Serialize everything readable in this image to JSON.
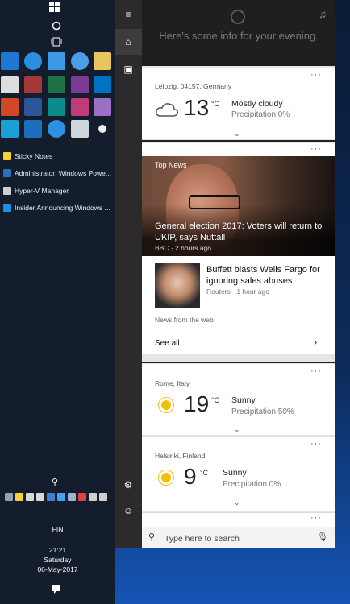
{
  "taskbar": {
    "running_apps": [
      {
        "label": "Sticky Notes",
        "color": "#f5d327"
      },
      {
        "label": "Administrator: Windows Powe...",
        "color": "#2e6fbf"
      },
      {
        "label": "Hyper-V Manager",
        "color": "#cfcfcf"
      },
      {
        "label": "Insider Announcing Windows ...",
        "color": "#1e8ee0"
      }
    ],
    "language": "FIN",
    "time": "21:21",
    "day": "Saturday",
    "date": "06-May-2017"
  },
  "cortana": {
    "greeting": "Here's some info for your evening."
  },
  "weather_cards": [
    {
      "location": "Leipzig, 04157, Germany",
      "temp": "13",
      "unit": "°C",
      "condition": "Mostly cloudy",
      "precipitation": "Precipitation 0%",
      "icon": "cloud-icon"
    },
    {
      "location": "Rome, Italy",
      "temp": "19",
      "unit": "°C",
      "condition": "Sunny",
      "precipitation": "Precipitation 50%",
      "icon": "sun-icon"
    },
    {
      "location": "Helsinki, Finland",
      "temp": "9",
      "unit": "°C",
      "condition": "Sunny",
      "precipitation": "Precipitation 0%",
      "icon": "sun-icon"
    }
  ],
  "news": {
    "header": "Top News",
    "top_story": {
      "title": "General election 2017: Voters will return to UKIP, says Nuttall",
      "source": "BBC · 2 hours ago"
    },
    "story": {
      "title": "Buffett blasts Wells Fargo for ignoring sales abuses",
      "source": "Reuters · 1 hour ago"
    },
    "web_note": "News from the web",
    "see_all": "See all"
  },
  "search": {
    "placeholder": "Type here to search"
  },
  "colors": {
    "taskbar": "#131d2b",
    "rail": "#2b2b2b",
    "panel_bg": "#e6e6e6"
  }
}
